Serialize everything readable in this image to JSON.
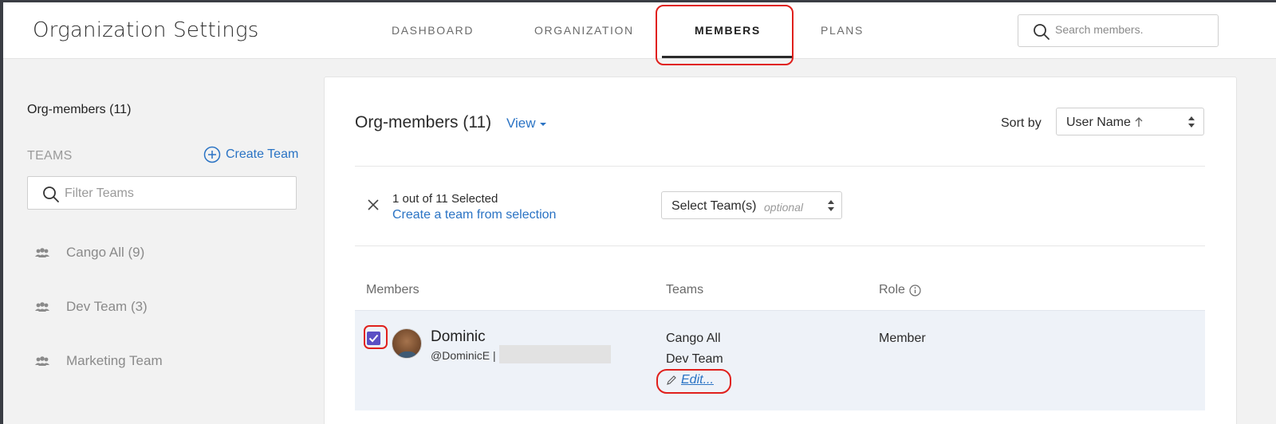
{
  "header": {
    "title": "Organization Settings",
    "tabs": [
      {
        "label": "DASHBOARD",
        "active": false
      },
      {
        "label": "ORGANIZATION",
        "active": false
      },
      {
        "label": "MEMBERS",
        "active": true
      },
      {
        "label": "PLANS",
        "active": false
      }
    ],
    "search_placeholder": "Search members."
  },
  "sidebar": {
    "title": "Org-members (11)",
    "teams_label": "TEAMS",
    "create_team_label": "Create Team",
    "filter_placeholder": "Filter Teams",
    "teams": [
      {
        "label": "Cango All (9)"
      },
      {
        "label": "Dev Team (3)"
      },
      {
        "label": "Marketing Team"
      }
    ]
  },
  "main": {
    "title": "Org-members (11)",
    "view_label": "View",
    "sort_label": "Sort by",
    "sort_value": "User Name",
    "selection": {
      "count_text": "1 out of 11 Selected",
      "create_link": "Create a team from selection",
      "team_select_label": "Select Team(s)",
      "team_select_hint": "optional"
    },
    "columns": [
      "Members",
      "Teams",
      "Role"
    ],
    "rows": [
      {
        "checked": true,
        "name": "Dominic",
        "handle": "@DominicE |",
        "teams": [
          "Cango All",
          "Dev Team"
        ],
        "edit_label": "Edit...",
        "role": "Member"
      }
    ]
  },
  "colors": {
    "accent": "#2a73c4",
    "highlight": "#e0201c",
    "checkbox": "#5b4fc4",
    "row_selected": "#eef2f8"
  },
  "icons": [
    "search-icon",
    "plus-circle-icon",
    "team-icon",
    "caret-down-icon",
    "close-icon",
    "info-icon",
    "pencil-icon",
    "checkmark-icon",
    "sort-arrows-icon",
    "arrow-up-icon"
  ]
}
